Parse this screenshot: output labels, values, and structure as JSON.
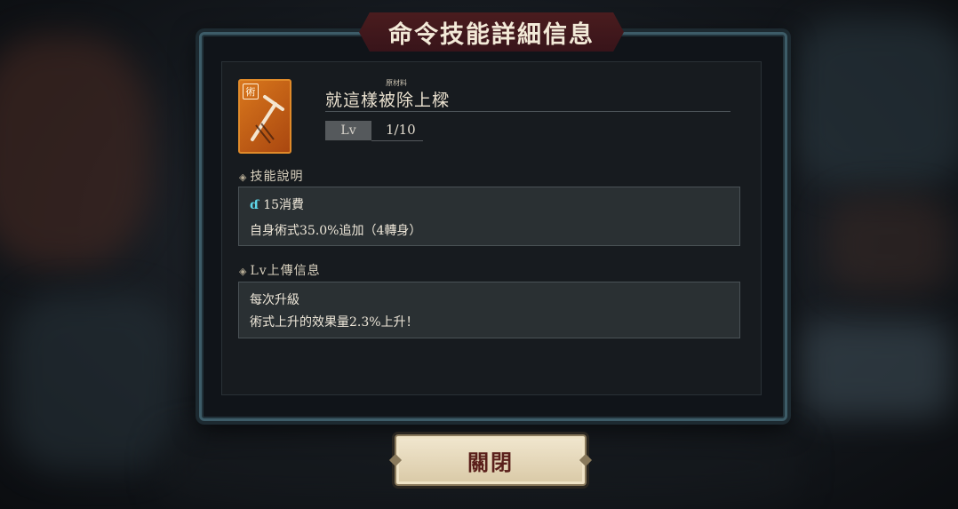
{
  "dialog": {
    "title": "命令技能詳細信息"
  },
  "skill": {
    "icon_badge": "術",
    "ruby": "原材料",
    "name": "就這樣被除上樑",
    "lv_label": "Lv",
    "level": "1/10"
  },
  "description": {
    "header": "技能說明",
    "cost": "15消費",
    "cost_icon": "cost-drop-icon",
    "effect": "自身術式35.0%追加（4轉身）"
  },
  "level_info": {
    "header": "Lv上傳信息",
    "line1": "每次升級",
    "line2": "術式上升的效果量2.3%上升！"
  },
  "buttons": {
    "close": "關閉"
  },
  "colors": {
    "accent_banner": "#4a1c1e",
    "frame": "#3d5c68",
    "icon_bg": "#d9771c",
    "cost_icon": "#5fd6e8"
  }
}
